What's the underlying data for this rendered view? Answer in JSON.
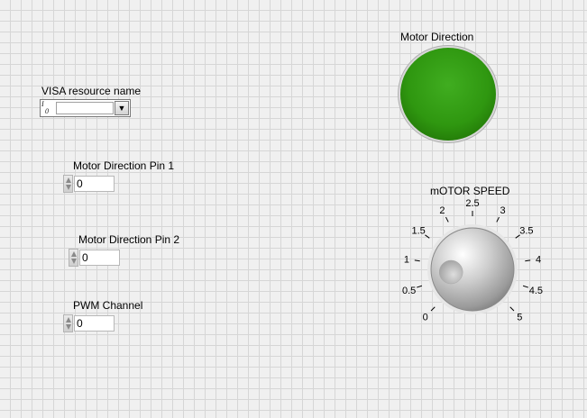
{
  "visa": {
    "label": "VISA resource name",
    "icon_top": "I",
    "icon_bottom": "0",
    "value": "",
    "dropdown_icon": "chevron-down-icon"
  },
  "pin1": {
    "label": "Motor Direction Pin 1",
    "value": "0"
  },
  "pin2": {
    "label": "Motor Direction Pin 2",
    "value": "0"
  },
  "pwm": {
    "label": "PWM Channel",
    "value": "0"
  },
  "led": {
    "label": "Motor Direction",
    "state": "on",
    "color": "#2f9710"
  },
  "knob": {
    "label": "mOTOR SPEED",
    "min": 0,
    "max": 5,
    "value": 0.7,
    "ticks": [
      "0",
      "0.5",
      "1",
      "1.5",
      "2",
      "2.5",
      "3",
      "3.5",
      "4",
      "4.5",
      "5"
    ]
  }
}
